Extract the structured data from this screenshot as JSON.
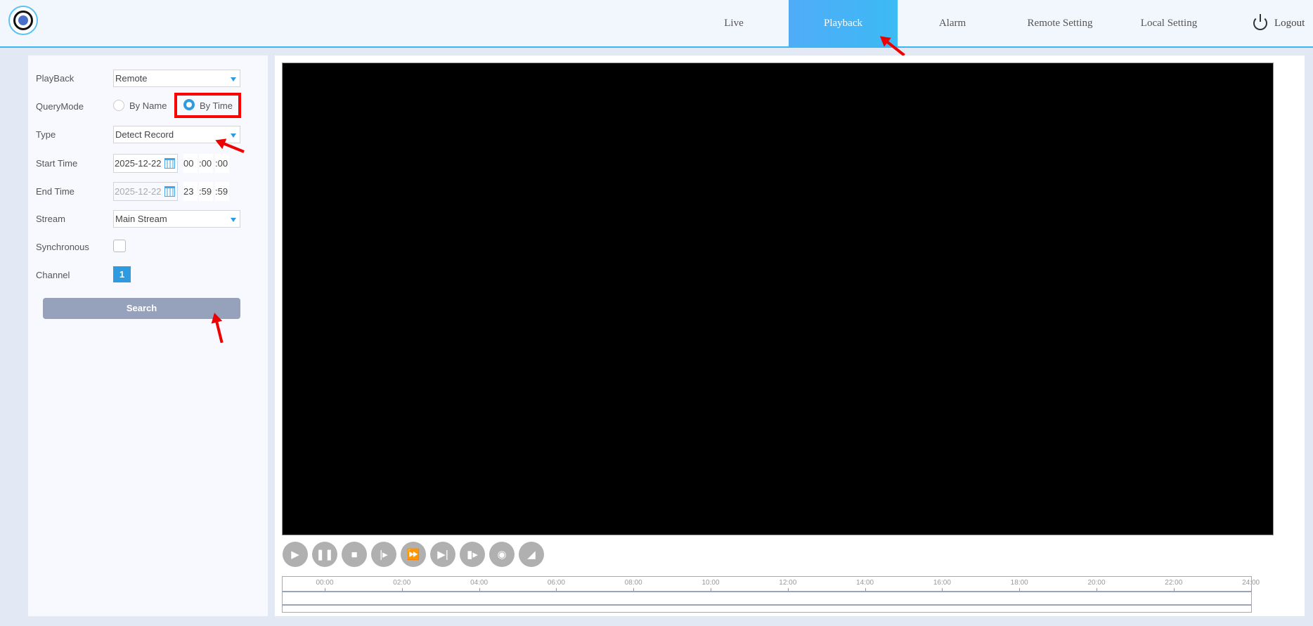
{
  "nav": {
    "items": [
      {
        "label": "Live"
      },
      {
        "label": "Playback",
        "active": true
      },
      {
        "label": "Alarm"
      },
      {
        "label": "Remote Setting"
      },
      {
        "label": "Local Setting"
      }
    ],
    "logout": "Logout"
  },
  "form": {
    "playback": {
      "label": "PlayBack",
      "value": "Remote"
    },
    "query_mode": {
      "label": "QueryMode",
      "options": [
        "By Name",
        "By Time"
      ],
      "selected": "By Time"
    },
    "type": {
      "label": "Type",
      "value": "Detect Record"
    },
    "start": {
      "label": "Start Time",
      "date": "2025-12-22",
      "h": "00",
      "m": ":00",
      "s": ":00"
    },
    "end": {
      "label": "End Time",
      "date": "2025-12-22",
      "h": "23",
      "m": ":59",
      "s": ":59"
    },
    "stream": {
      "label": "Stream",
      "value": "Main Stream"
    },
    "synchronous": {
      "label": "Synchronous",
      "checked": false
    },
    "channel": {
      "label": "Channel",
      "value": "1"
    },
    "search": "Search"
  },
  "controls": [
    "play",
    "pause",
    "stop",
    "slow",
    "fast",
    "next-frame",
    "record",
    "snapshot",
    "volume"
  ],
  "timeline": {
    "ticks": [
      "00:00",
      "02:00",
      "04:00",
      "06:00",
      "08:00",
      "10:00",
      "12:00",
      "14:00",
      "16:00",
      "18:00",
      "20:00",
      "22:00",
      "24:00"
    ]
  },
  "colors": {
    "accent": "#2e9be0",
    "highlight": "#ff0000"
  }
}
